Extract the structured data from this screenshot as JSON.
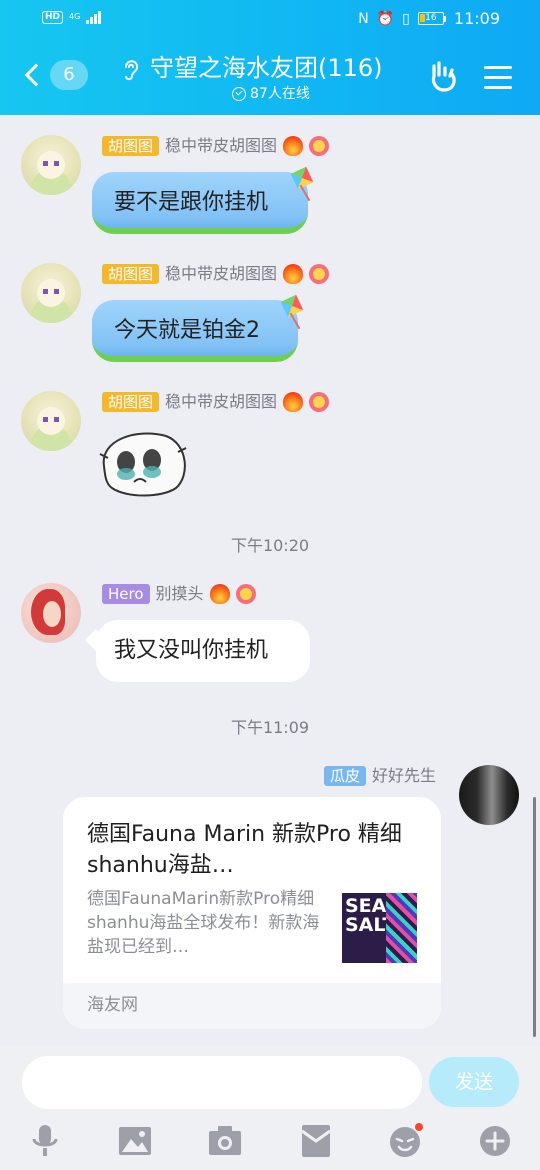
{
  "status_bar": {
    "left": {
      "hd": "HD",
      "network": "4G"
    },
    "right": {
      "battery": "16",
      "time": "11:09"
    }
  },
  "header": {
    "back_count": "6",
    "title": "守望之海水友团(116)",
    "online": "87人在线"
  },
  "messages": [
    {
      "tag": "胡图图",
      "name": "稳中带皮胡图图",
      "text": "要不是跟你挂机"
    },
    {
      "tag": "胡图图",
      "name": "稳中带皮胡图图",
      "text": "今天就是铂金2"
    },
    {
      "tag": "胡图图",
      "name": "稳中带皮胡图图",
      "sticker": "crying-face-sticker"
    },
    {
      "time": "下午10:20"
    },
    {
      "tag": "Hero",
      "name": "别摸头",
      "text": "我又没叫你挂机"
    },
    {
      "time": "下午11:09"
    },
    {
      "tag": "瓜皮",
      "name": "好好先生",
      "card": {
        "title": "德国Fauna Marin 新款Pro 精细shanhu海盐…",
        "desc": "德国FaunaMarin新款Pro精细shanhu海盐全球发布！新款海盐现已经到…",
        "thumb_text": "SEA SALT",
        "source": "海友网"
      }
    }
  ],
  "input": {
    "placeholder": "",
    "send_label": "发送"
  },
  "toolbar": {
    "icons": [
      "microphone-icon",
      "image-icon",
      "camera-icon",
      "red-packet-icon",
      "emoji-icon",
      "plus-icon"
    ]
  },
  "colors": {
    "header_start": "#16c7f0",
    "header_end": "#0fa9f5",
    "tag_yellow": "#f4b82c",
    "tag_purple": "#a88be2",
    "tag_blue": "#79b7ee",
    "send_button": "#b6ebfb",
    "background": "#eceef3"
  }
}
